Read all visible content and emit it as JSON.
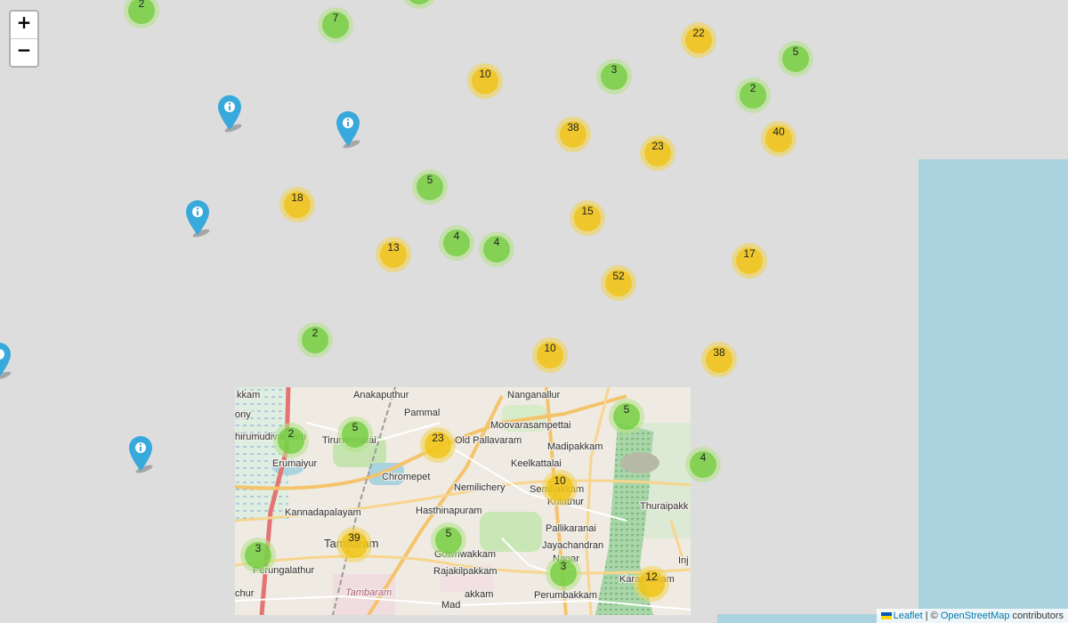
{
  "zoom": {
    "in_label": "+",
    "out_label": "−"
  },
  "clusters": [
    {
      "count": "2",
      "size": "small"
    },
    {
      "count": "7",
      "size": "small"
    },
    {
      "count": "22",
      "size": "medium"
    },
    {
      "count": "5",
      "size": "small"
    },
    {
      "count": "10",
      "size": "medium"
    },
    {
      "count": "3",
      "size": "small"
    },
    {
      "count": "2",
      "size": "small"
    },
    {
      "count": "38",
      "size": "medium"
    },
    {
      "count": "23",
      "size": "medium"
    },
    {
      "count": "40",
      "size": "medium"
    },
    {
      "count": "5",
      "size": "small"
    },
    {
      "count": "18",
      "size": "medium"
    },
    {
      "count": "15",
      "size": "medium"
    },
    {
      "count": "4",
      "size": "small"
    },
    {
      "count": "4",
      "size": "small"
    },
    {
      "count": "13",
      "size": "medium"
    },
    {
      "count": "17",
      "size": "medium"
    },
    {
      "count": "52",
      "size": "medium"
    },
    {
      "count": "2",
      "size": "small"
    },
    {
      "count": "10",
      "size": "medium"
    },
    {
      "count": "38",
      "size": "medium"
    },
    {
      "count": "5",
      "size": "small"
    },
    {
      "count": "2",
      "size": "small"
    },
    {
      "count": "5",
      "size": "small"
    },
    {
      "count": "23",
      "size": "medium"
    },
    {
      "count": "4",
      "size": "small"
    },
    {
      "count": "10",
      "size": "medium"
    },
    {
      "count": "39",
      "size": "medium"
    },
    {
      "count": "3",
      "size": "small"
    },
    {
      "count": "5",
      "size": "small"
    },
    {
      "count": "3",
      "size": "small"
    },
    {
      "count": "12",
      "size": "medium"
    }
  ],
  "markers": [
    {
      "icon": "info-icon",
      "color": "#38a9dc"
    },
    {
      "icon": "info-icon",
      "color": "#38a9dc"
    },
    {
      "icon": "info-icon",
      "color": "#38a9dc"
    },
    {
      "icon": "info-icon",
      "color": "#38a9dc"
    },
    {
      "icon": "info-icon",
      "color": "#38a9dc"
    }
  ],
  "places": [
    "kkam",
    "Anakaputhur",
    "Nanganallur",
    "Pammal",
    "Moovarasampettai",
    "ony",
    "hirumudivakkam",
    "Tirunermalai",
    "Old Pallavaram",
    "Madipakkam",
    "Erumaiyur",
    "Keelkattalai",
    "Chromepet",
    "Nemilichery",
    "Sembakkam",
    "Kulathur",
    "Thuraipakk",
    "Hasthinapuram",
    "Kannadapalayam",
    "Pallikaranai",
    "Tambaram",
    "Gowriwakkam",
    "Jayachandran",
    "Nagar",
    "Perungalathur",
    "Rajakilpakkam",
    "Karapakkam",
    "Inj",
    "chur",
    "Tambaram",
    "akkam",
    "Perumbakkam",
    "Mad"
  ],
  "attribution": {
    "leaflet": "Leaflet",
    "separator": " | © ",
    "osm": "OpenStreetMap",
    "suffix": " contributors"
  },
  "colors": {
    "background": "#dddddd",
    "sea": "#aad3df",
    "cluster_small": "#6ecc39",
    "cluster_medium": "#f0c20c",
    "marker": "#38a9dc"
  }
}
